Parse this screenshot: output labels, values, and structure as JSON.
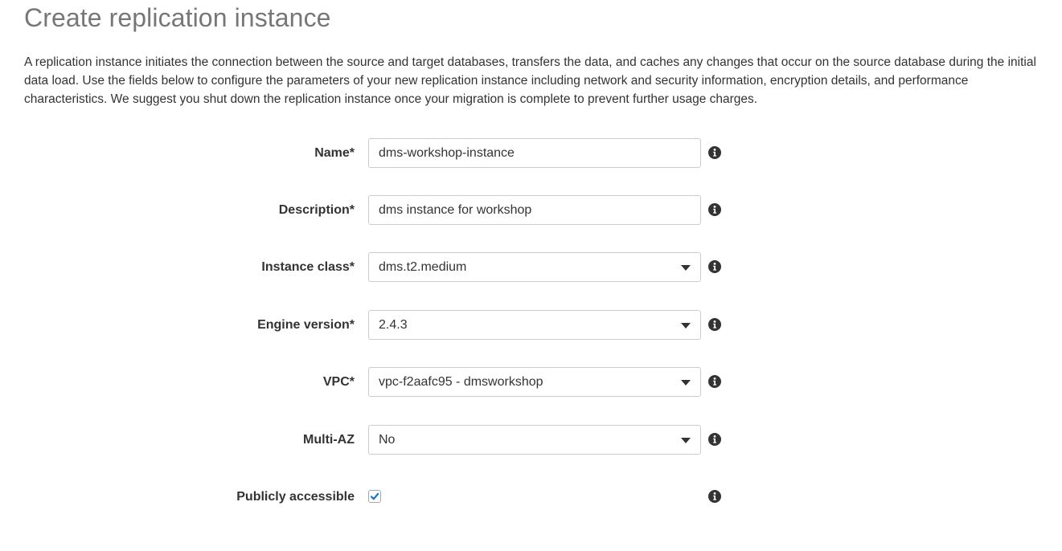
{
  "header": {
    "title": "Create replication instance",
    "description": "A replication instance initiates the connection between the source and target databases, transfers the data, and caches any changes that occur on the source database during the initial data load. Use the fields below to configure the parameters of your new replication instance including network and security information, encryption details, and performance characteristics. We suggest you shut down the replication instance once your migration is complete to prevent further usage charges."
  },
  "form": {
    "name": {
      "label": "Name*",
      "value": "dms-workshop-instance"
    },
    "description": {
      "label": "Description*",
      "value": "dms instance for workshop"
    },
    "instance_class": {
      "label": "Instance class*",
      "value": "dms.t2.medium"
    },
    "engine_version": {
      "label": "Engine version*",
      "value": "2.4.3"
    },
    "vpc": {
      "label": "VPC*",
      "value": "vpc-f2aafc95 - dmsworkshop"
    },
    "multi_az": {
      "label": "Multi-AZ",
      "value": "No"
    },
    "publicly_accessible": {
      "label": "Publicly accessible",
      "checked": true
    }
  },
  "icons": {
    "info": "info-icon",
    "dropdown": "caret-down-icon",
    "check": "checkmark-icon"
  },
  "colors": {
    "title": "#777777",
    "text": "#333333",
    "border": "#cccccc",
    "check": "#1a73c7"
  }
}
